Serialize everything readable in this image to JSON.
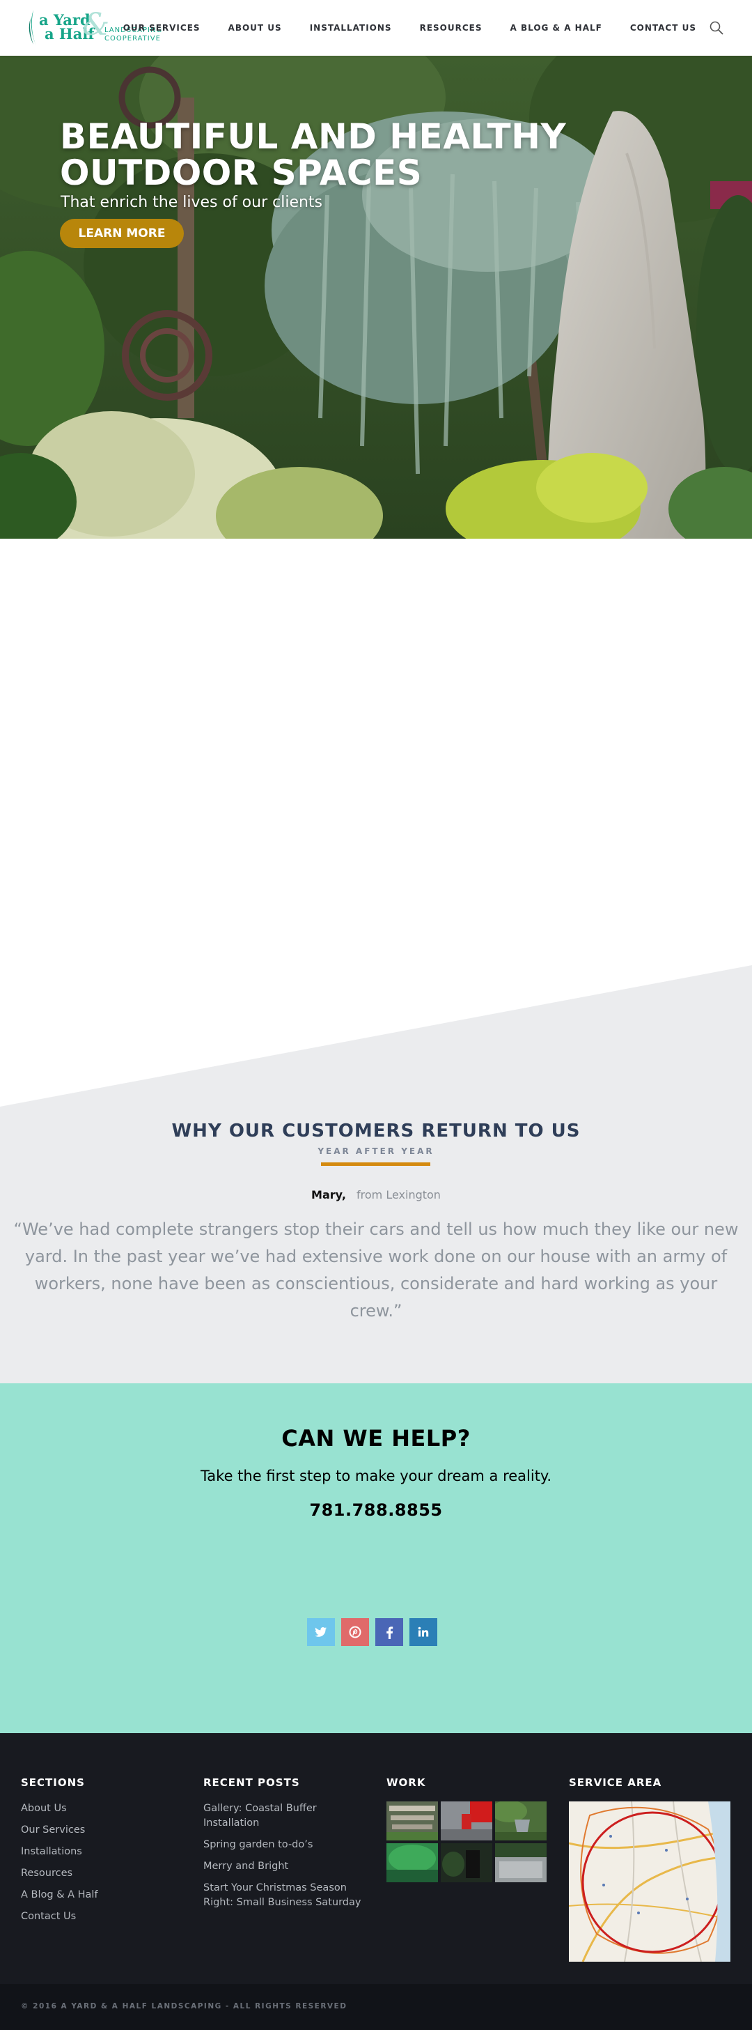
{
  "colors": {
    "logo_teal": "#17a589",
    "accent_gold": "#b8860b",
    "heading_navy": "#2f3e58",
    "rule_orange": "#d48a10",
    "cta_bg": "#98e2d1",
    "footer_bg": "#181a20",
    "twitter": "#6ec6ec",
    "pinterest": "#e06a6a",
    "facebook": "#4a66b6",
    "linkedin": "#2b7fb6"
  },
  "logo": {
    "line1": "a Yard",
    "line2": "a Half",
    "ampersand": "&",
    "tagline1": "LANDSCAPING",
    "tagline2": "COOPERATIVE"
  },
  "nav": {
    "items": [
      {
        "label": "OUR SERVICES"
      },
      {
        "label": "ABOUT US"
      },
      {
        "label": "INSTALLATIONS"
      },
      {
        "label": "RESOURCES"
      },
      {
        "label": "A BLOG & A HALF"
      },
      {
        "label": "CONTACT US"
      }
    ],
    "search_icon": "search-icon"
  },
  "hero": {
    "title_line1": "BEAUTIFUL AND HEALTHY",
    "title_line2": "OUTDOOR SPACES",
    "subtitle": "That enrich the lives of our clients",
    "button": "LEARN MORE"
  },
  "testimonial": {
    "heading": "WHY OUR CUSTOMERS RETURN TO US",
    "subheading": "YEAR AFTER YEAR",
    "author": "Mary,",
    "location": "from Lexington",
    "quote": "“We’ve had complete strangers stop their cars and tell us how much they like our new yard. In the past year we’ve had extensive work done on our house with an army of workers, none have been as conscientious, considerate and hard working as your crew.”"
  },
  "cta": {
    "title": "CAN WE HELP?",
    "text": "Take the first step to make your dream a reality.",
    "phone": "781.788.8855",
    "social": [
      {
        "name": "twitter-icon",
        "glyph": "t"
      },
      {
        "name": "pinterest-icon",
        "glyph": "p"
      },
      {
        "name": "facebook-icon",
        "glyph": "f"
      },
      {
        "name": "linkedin-icon",
        "glyph": "in"
      }
    ]
  },
  "footer": {
    "sections": {
      "heading": "SECTIONS",
      "links": [
        "About Us",
        "Our Services",
        "Installations",
        "Resources",
        "A Blog & A Half",
        "Contact Us"
      ]
    },
    "recent_posts": {
      "heading": "RECENT POSTS",
      "links": [
        "Gallery: Coastal Buffer Installation",
        "Spring garden to-do’s",
        "Merry and Bright",
        "Start Your Christmas Season Right: Small Business Saturday"
      ]
    },
    "work": {
      "heading": "WORK"
    },
    "service_area": {
      "heading": "SERVICE AREA"
    }
  },
  "copyright": "© 2016 A YARD & A HALF LANDSCAPING - ALL RIGHTS RESERVED"
}
